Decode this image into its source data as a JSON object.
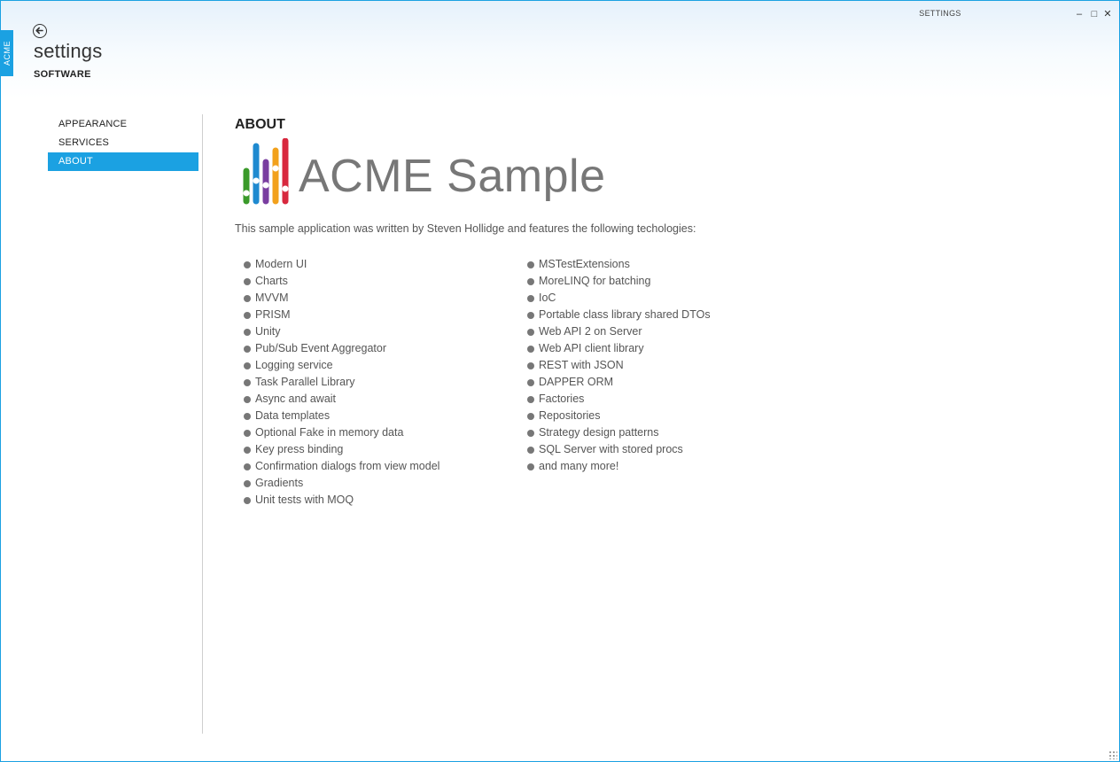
{
  "window": {
    "title": "SETTINGS",
    "side_tab": "ACME",
    "controls": {
      "minimize": "–",
      "maximize": "□",
      "close": "✕"
    }
  },
  "header": {
    "back_icon": "back-arrow-icon",
    "title": "settings",
    "subtitle": "SOFTWARE"
  },
  "nav": {
    "items": [
      {
        "label": "APPEARANCE",
        "selected": false
      },
      {
        "label": "SERVICES",
        "selected": false
      },
      {
        "label": "ABOUT",
        "selected": true
      }
    ]
  },
  "about": {
    "heading": "ABOUT",
    "brand": "ACME Sample",
    "intro": "This sample application was written by Steven Hollidge and features the following techologies:",
    "tech_col1": [
      "Modern UI",
      "Charts",
      "MVVM",
      "PRISM",
      "Unity",
      "Pub/Sub Event Aggregator",
      "Logging service",
      "Task Parallel Library",
      "Async and await",
      "Data templates",
      "Optional Fake in memory data",
      "Key press binding",
      "Confirmation dialogs from view model",
      "Gradients",
      "Unit tests with MOQ"
    ],
    "tech_col2": [
      "MSTestExtensions",
      "MoreLINQ for batching",
      "IoC",
      "Portable class library shared DTOs",
      "Web API 2 on Server",
      "Web API client library",
      "REST with JSON",
      "DAPPER ORM",
      "Factories",
      "Repositories",
      "Strategy design patterns",
      "SQL Server with stored procs",
      "and many more!"
    ]
  },
  "colors": {
    "accent": "#1ba1e2",
    "logo_bars": [
      "#3a9a2a",
      "#1f8ad0",
      "#7a3ea0",
      "#f2a11c",
      "#d8283e"
    ]
  }
}
